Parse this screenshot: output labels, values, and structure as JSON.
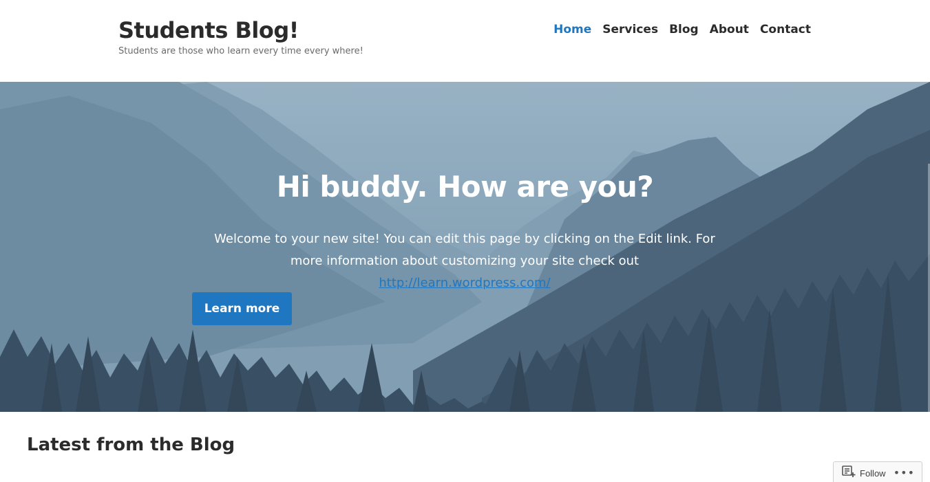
{
  "header": {
    "site_title": "Students Blog!",
    "tagline": "Students are those who learn every time every where!",
    "nav": [
      {
        "label": "Home",
        "active": true
      },
      {
        "label": "Services",
        "active": false
      },
      {
        "label": "Blog",
        "active": false
      },
      {
        "label": "About",
        "active": false
      },
      {
        "label": "Contact",
        "active": false
      }
    ]
  },
  "hero": {
    "heading": "Hi buddy. How are you?",
    "text_before_link": "Welcome to your new site! You can edit this page by clicking on the Edit link. For more information about customizing your site check out ",
    "link_text": "http://learn.wordpress.com/",
    "button_label": "Learn more"
  },
  "blog": {
    "section_title": "Latest from the Blog"
  },
  "follow_widget": {
    "follow_label": "Follow",
    "more_label": "•••",
    "icon": "follow-reader-icon"
  },
  "colors": {
    "accent": "#1e77c0",
    "text": "#2b2b2b"
  }
}
